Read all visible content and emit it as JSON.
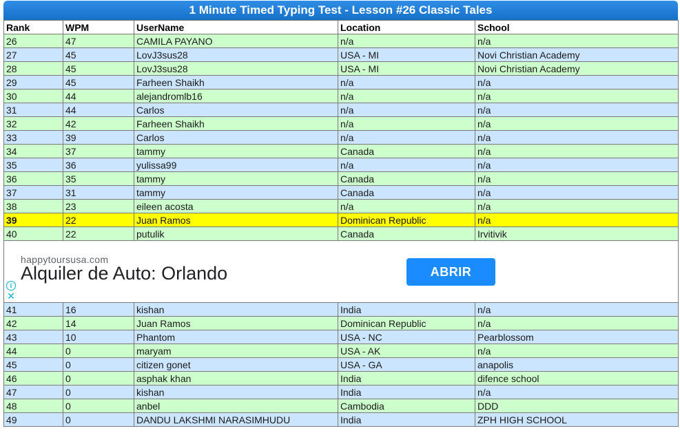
{
  "title": "1 Minute Timed Typing Test - Lesson #26 Classic Tales",
  "columns": [
    "Rank",
    "WPM",
    "UserName",
    "Location",
    "School"
  ],
  "rows_before_ad": [
    {
      "rank": "26",
      "wpm": "47",
      "user": "CAMILA PAYANO",
      "location": "n/a",
      "school": "n/a"
    },
    {
      "rank": "27",
      "wpm": "45",
      "user": "LovJ3sus28",
      "location": "USA - MI",
      "school": "Novi Christian Academy"
    },
    {
      "rank": "28",
      "wpm": "45",
      "user": "LovJ3sus28",
      "location": "USA - MI",
      "school": "Novi Christian Academy"
    },
    {
      "rank": "29",
      "wpm": "45",
      "user": "Farheen Shaikh",
      "location": "n/a",
      "school": "n/a"
    },
    {
      "rank": "30",
      "wpm": "44",
      "user": "alejandromlb16",
      "location": "n/a",
      "school": "n/a"
    },
    {
      "rank": "31",
      "wpm": "44",
      "user": "Carlos",
      "location": "n/a",
      "school": "n/a"
    },
    {
      "rank": "32",
      "wpm": "42",
      "user": "Farheen Shaikh",
      "location": "n/a",
      "school": "n/a"
    },
    {
      "rank": "33",
      "wpm": "39",
      "user": "Carlos",
      "location": "n/a",
      "school": "n/a"
    },
    {
      "rank": "34",
      "wpm": "37",
      "user": "tammy",
      "location": "Canada",
      "school": "n/a"
    },
    {
      "rank": "35",
      "wpm": "36",
      "user": "yulissa99",
      "location": "n/a",
      "school": "n/a"
    },
    {
      "rank": "36",
      "wpm": "35",
      "user": "tammy",
      "location": "Canada",
      "school": "n/a"
    },
    {
      "rank": "37",
      "wpm": "31",
      "user": "tammy",
      "location": "Canada",
      "school": "n/a"
    },
    {
      "rank": "38",
      "wpm": "23",
      "user": "eileen acosta",
      "location": "n/a",
      "school": "n/a"
    },
    {
      "rank": "39",
      "wpm": "22",
      "user": "Juan Ramos",
      "location": "Dominican Republic",
      "school": "n/a"
    },
    {
      "rank": "40",
      "wpm": "22",
      "user": "putulik",
      "location": "Canada",
      "school": "Irvitivik"
    }
  ],
  "ad": {
    "domain": "happytoursusa.com",
    "headline": "Alquiler de Auto: Orlando",
    "button": "ABRIR",
    "info_glyph": "i",
    "close_glyph": "✕"
  },
  "rows_after_ad": [
    {
      "rank": "41",
      "wpm": "16",
      "user": "kishan",
      "location": "India",
      "school": "n/a"
    },
    {
      "rank": "42",
      "wpm": "14",
      "user": "Juan Ramos",
      "location": "Dominican Republic",
      "school": "n/a"
    },
    {
      "rank": "43",
      "wpm": "10",
      "user": "Phantom",
      "location": "USA - NC",
      "school": "Pearblossom"
    },
    {
      "rank": "44",
      "wpm": "0",
      "user": "maryam",
      "location": "USA - AK",
      "school": "n/a"
    },
    {
      "rank": "45",
      "wpm": "0",
      "user": "citizen gonet",
      "location": "USA - GA",
      "school": "anapolis"
    },
    {
      "rank": "46",
      "wpm": "0",
      "user": "asphak khan",
      "location": "India",
      "school": "difence school"
    },
    {
      "rank": "47",
      "wpm": "0",
      "user": "kishan",
      "location": "India",
      "school": "n/a"
    },
    {
      "rank": "48",
      "wpm": "0",
      "user": "anbel",
      "location": "Cambodia",
      "school": "DDD"
    },
    {
      "rank": "49",
      "wpm": "0",
      "user": "DANDU LAKSHMI NARASIMHUDU",
      "location": "India",
      "school": "ZPH HIGH SCHOOL"
    }
  ],
  "highlight_rank": "39",
  "colors": {
    "title_bar": "#1a78d4",
    "row_green": "#ccffcc",
    "row_blue": "#cce5ff",
    "row_highlight": "#ffff00",
    "ad_button": "#1a8cff"
  }
}
